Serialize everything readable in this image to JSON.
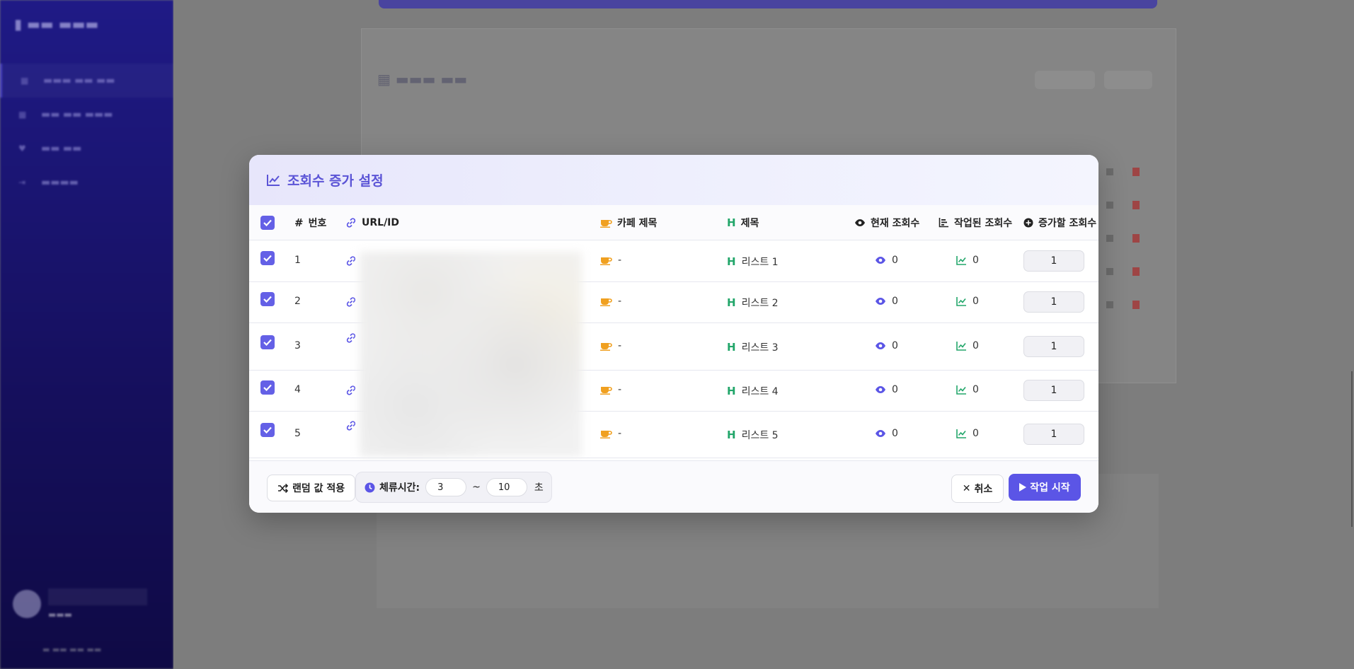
{
  "modal": {
    "title": "조회수 증가 설정",
    "columns": {
      "number": "번호",
      "url": "URL/ID",
      "cafe_title": "카페 제목",
      "title": "제목",
      "current_views": "현재 조회수",
      "done_views": "작업된 조회수",
      "add_views": "증가할 조회수"
    },
    "rows": [
      {
        "num": "1",
        "cafe": "-",
        "title": "리스트 1",
        "current": "0",
        "done": "0",
        "add": "1"
      },
      {
        "num": "2",
        "cafe": "-",
        "title": "리스트 2",
        "current": "0",
        "done": "0",
        "add": "1"
      },
      {
        "num": "3",
        "cafe": "-",
        "title": "리스트 3",
        "current": "0",
        "done": "0",
        "add": "1"
      },
      {
        "num": "4",
        "cafe": "-",
        "title": "리스트 4",
        "current": "0",
        "done": "0",
        "add": "1"
      },
      {
        "num": "5",
        "cafe": "-",
        "title": "리스트 5",
        "current": "0",
        "done": "0",
        "add": "1"
      }
    ],
    "footer": {
      "random_button": "랜덤 값 적용",
      "dwell_label": "체류시간:",
      "dwell_min": "3",
      "dwell_sep": "~",
      "dwell_max": "10",
      "dwell_unit": "초",
      "cancel_button": "취소",
      "start_button": "작업 시작"
    }
  },
  "colors": {
    "accent": "#5b55e6",
    "title": "#5b54d6",
    "cafe_icon": "#f0a020",
    "heading_icon": "#22a66a",
    "views_icon": "#5b55e6",
    "chart_icon": "#22a66a"
  },
  "icons": {
    "title": "chart-line-icon",
    "number": "hash-icon",
    "url": "link-icon",
    "cafe": "coffee-icon",
    "heading": "heading-icon",
    "current": "eye-icon",
    "done": "bar-chart-icon",
    "add": "plus-circle-icon",
    "random": "shuffle-icon",
    "dwell": "clock-icon",
    "cancel": "close-icon",
    "start": "play-icon"
  }
}
